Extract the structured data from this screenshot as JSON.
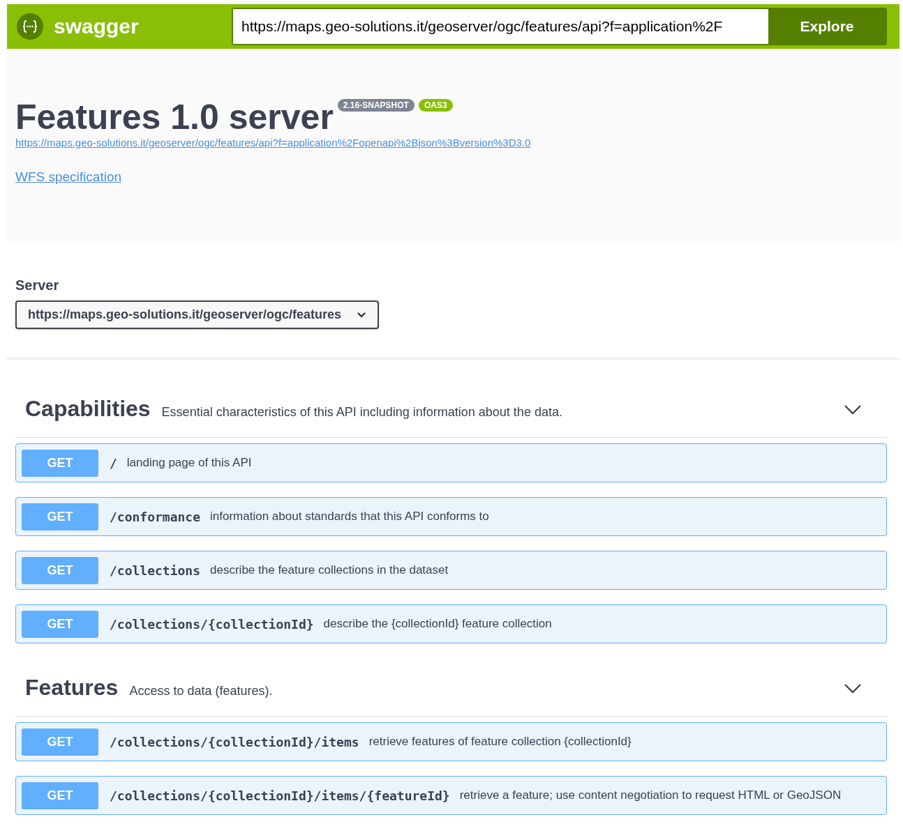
{
  "topbar": {
    "logo_text": "swagger",
    "url_value": "https://maps.geo-solutions.it/geoserver/ogc/features/api?f=application%2F",
    "explore_button": "Explore"
  },
  "info": {
    "title": "Features 1.0 server",
    "version_badge": "2.16-SNAPSHOT",
    "spec_badge": "OAS3",
    "spec_url": "https://maps.geo-solutions.it/geoserver/ogc/features/api?f=application%2Fopenapi%2Bjson%3Bversion%3D3.0",
    "external_link": "WFS specification"
  },
  "servers": {
    "label": "Server",
    "selected": "https://maps.geo-solutions.it/geoserver/ogc/features"
  },
  "tags": [
    {
      "name": "Capabilities",
      "description": "Essential characteristics of this API including information about the data.",
      "expanded": true,
      "operations": [
        {
          "method": "GET",
          "path": "/",
          "summary": "landing page of this API"
        },
        {
          "method": "GET",
          "path": "/conformance",
          "summary": "information about standards that this API conforms to"
        },
        {
          "method": "GET",
          "path": "/collections",
          "summary": "describe the feature collections in the dataset"
        },
        {
          "method": "GET",
          "path": "/collections/{collectionId}",
          "summary": "describe the {collectionId} feature collection"
        }
      ]
    },
    {
      "name": "Features",
      "description": "Access to data (features).",
      "expanded": true,
      "operations": [
        {
          "method": "GET",
          "path": "/collections/{collectionId}/items",
          "summary": "retrieve features of feature collection {collectionId}"
        },
        {
          "method": "GET",
          "path": "/collections/{collectionId}/items/{featureId}",
          "summary": "retrieve a feature; use content negotiation to request HTML or GeoJSON"
        }
      ]
    }
  ]
}
